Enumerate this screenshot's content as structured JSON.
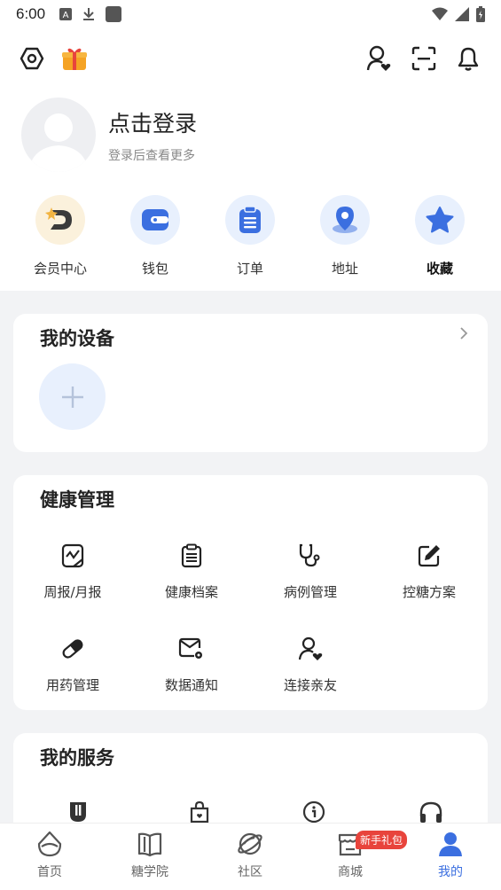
{
  "status_bar": {
    "time": "6:00"
  },
  "profile": {
    "login_title": "点击登录",
    "login_subtitle": "登录后查看更多"
  },
  "quick_actions": [
    {
      "label": "会员中心",
      "icon": "vip-icon"
    },
    {
      "label": "钱包",
      "icon": "wallet-icon"
    },
    {
      "label": "订单",
      "icon": "order-icon"
    },
    {
      "label": "地址",
      "icon": "location-icon"
    },
    {
      "label": "收藏",
      "icon": "star-icon"
    }
  ],
  "devices": {
    "title": "我的设备",
    "add_icon": "plus-icon"
  },
  "health": {
    "title": "健康管理",
    "items": [
      {
        "label": "周报/月报",
        "icon": "report-icon"
      },
      {
        "label": "健康档案",
        "icon": "record-icon"
      },
      {
        "label": "病例管理",
        "icon": "stethoscope-icon"
      },
      {
        "label": "控糖方案",
        "icon": "edit-plan-icon"
      },
      {
        "label": "用药管理",
        "icon": "pill-icon"
      },
      {
        "label": "数据通知",
        "icon": "mail-settings-icon"
      },
      {
        "label": "连接亲友",
        "icon": "user-heart-icon"
      }
    ]
  },
  "services": {
    "title": "我的服务"
  },
  "tabbar": {
    "items": [
      {
        "label": "首页",
        "icon": "home-icon"
      },
      {
        "label": "糖学院",
        "icon": "book-icon"
      },
      {
        "label": "社区",
        "icon": "planet-icon"
      },
      {
        "label": "商城",
        "icon": "shop-icon"
      },
      {
        "label": "我的",
        "icon": "user-icon"
      }
    ],
    "badge": "新手礼包",
    "active_color": "#3b6fe0"
  }
}
